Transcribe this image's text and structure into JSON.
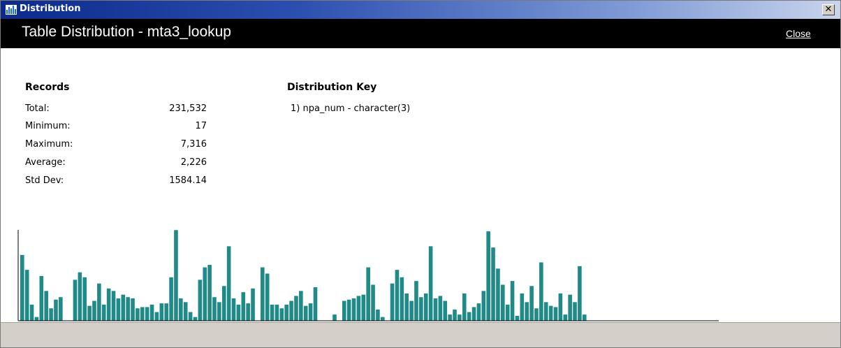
{
  "window": {
    "title": "Distribution",
    "close_glyph": "✕"
  },
  "header": {
    "title": "Table Distribution - mta3_lookup",
    "close_label": "Close"
  },
  "records": {
    "heading": "Records",
    "rows": [
      {
        "label": "Total:",
        "value": "231,532"
      },
      {
        "label": "Minimum:",
        "value": "17"
      },
      {
        "label": "Maximum:",
        "value": "7,316"
      },
      {
        "label": "Average:",
        "value": "2,226"
      },
      {
        "label": "Std Dev:",
        "value": "1584.14"
      }
    ]
  },
  "distribution_key": {
    "heading": "Distribution Key",
    "items": [
      "1)  npa_num  - character(3)"
    ]
  },
  "icons": {
    "app": "bar-chart-icon",
    "close": "close-icon"
  },
  "colors": {
    "bar": "#1f8a87",
    "header_bg": "#000000",
    "titlebar_start": "#0b2a8c"
  },
  "chart_data": {
    "type": "bar",
    "ylim": [
      0,
      7316
    ],
    "values": [
      5300,
      4100,
      1300,
      300,
      3600,
      2400,
      1000,
      1700,
      1900,
      0,
      0,
      3300,
      3900,
      3500,
      1200,
      1600,
      3000,
      1300,
      2600,
      2400,
      1800,
      2100,
      1900,
      1800,
      1000,
      1100,
      1100,
      1300,
      700,
      1400,
      1400,
      3500,
      7300,
      1800,
      1500,
      700,
      300,
      3300,
      4300,
      4500,
      1900,
      1500,
      2800,
      6000,
      1800,
      1300,
      2300,
      1400,
      2600,
      0,
      4300,
      3800,
      1300,
      1300,
      1000,
      1300,
      1600,
      2000,
      2400,
      1200,
      1400,
      2700,
      0,
      0,
      0,
      500,
      0,
      1600,
      1700,
      1800,
      2000,
      2100,
      4300,
      2900,
      900,
      300,
      0,
      3000,
      4100,
      3500,
      2200,
      1600,
      3200,
      1900,
      2200,
      6000,
      1800,
      2000,
      1600,
      500,
      900,
      500,
      2200,
      700,
      1100,
      1400,
      2400,
      7200,
      5900,
      4200,
      2900,
      1300,
      3200,
      400,
      2200,
      1500,
      2800,
      1000,
      4700,
      1500,
      1200,
      1100,
      2200,
      500,
      2100,
      1500,
      4400,
      500
    ]
  }
}
